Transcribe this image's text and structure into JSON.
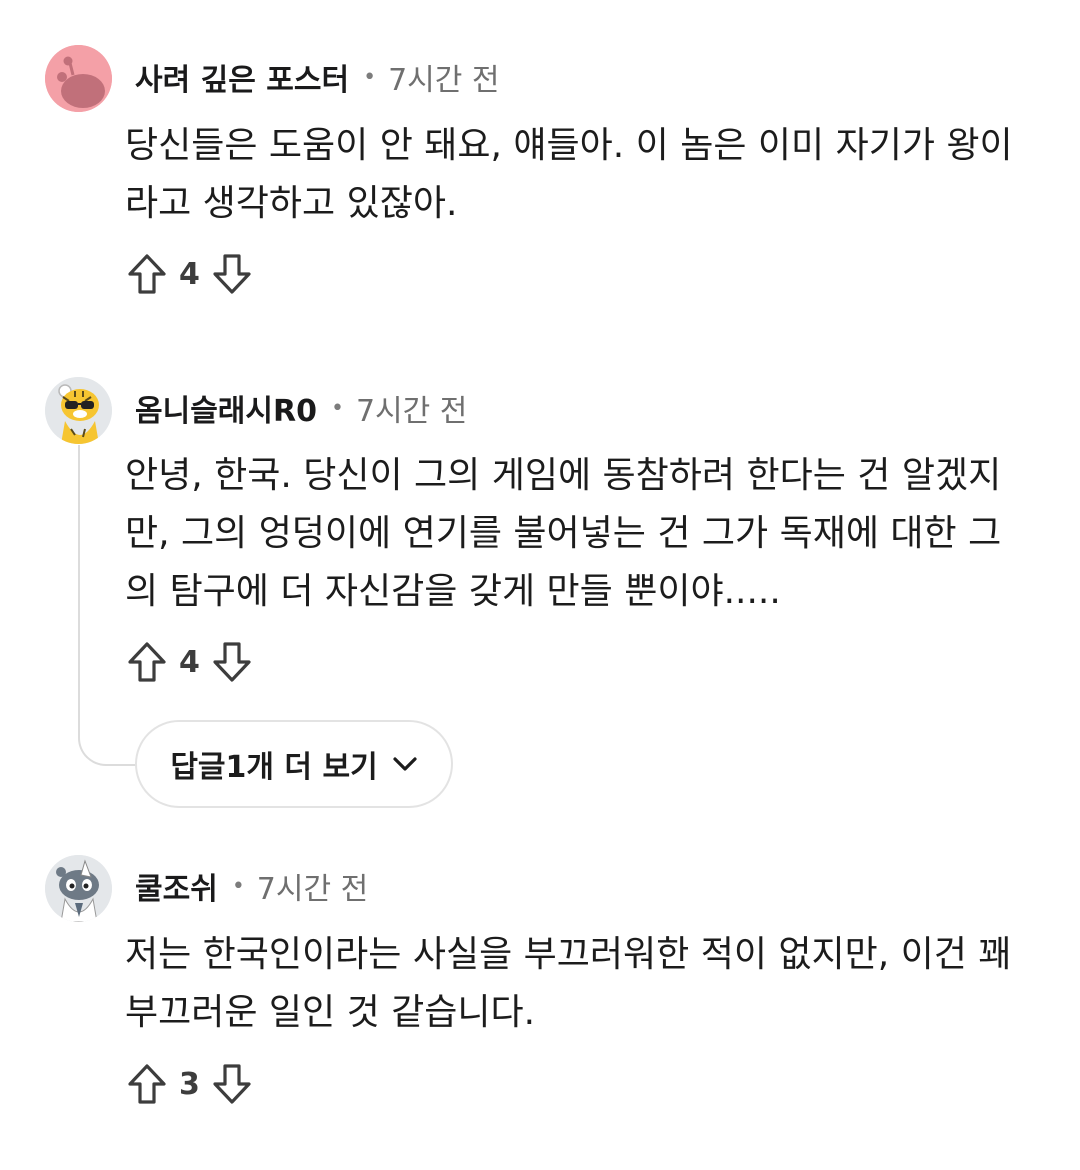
{
  "comments": [
    {
      "username": "사려 깊은 포스터",
      "separator": "•",
      "time": "7시간 전",
      "body": "당신들은 도움이 안 돼요, 얘들아. 이 놈은 이미 자기가 왕이\n라고 생각하고 있잖아.",
      "votes": "4",
      "avatar_icon": "snoo-default-avatar-icon",
      "avatar_color": "#f4a0a7"
    },
    {
      "username": "옴니슬래시R0",
      "separator": "•",
      "time": "7시간 전",
      "body": "안녕, 한국. 당신이 그의 게임에 동참하려 한다는 건 알겠지\n만, 그의 엉덩이에 연기를 불어넣는 건 그가 독재에 대한 그\n의 탐구에 더 자신감을 갖게 만들 뿐이야.....",
      "votes": "4",
      "avatar_icon": "tiger-sunglasses-avatar-icon",
      "more_replies_label": "답글1개 더 보기"
    },
    {
      "username": "쿨조쉬",
      "separator": "•",
      "time": "7시간 전",
      "body": "저는 한국인이라는 사실을 부끄러워한 적이 없지만, 이건 꽤\n부끄러운 일인 것 같습니다.",
      "votes": "3",
      "avatar_icon": "unicorn-snoo-avatar-icon"
    }
  ],
  "icons": {
    "upvote": "upvote-arrow-icon",
    "downvote": "downvote-arrow-icon",
    "expand": "chevron-down-icon"
  },
  "colors": {
    "meta_text": "#6f6f6f",
    "thread_line": "#dcdcdc"
  }
}
